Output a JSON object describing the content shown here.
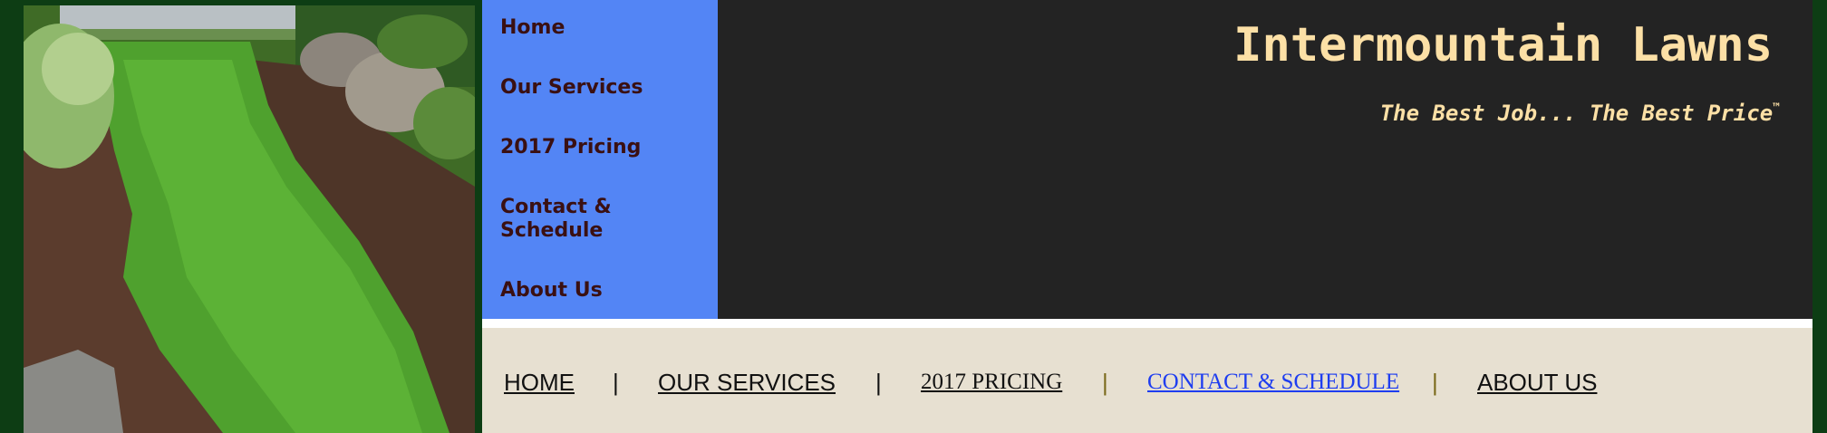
{
  "site": {
    "title": "Intermountain Lawns",
    "tagline": "The Best Job... The Best Price",
    "trademark": "™"
  },
  "side_nav": {
    "items": [
      {
        "label": "Home"
      },
      {
        "label": "Our Services"
      },
      {
        "label": "2017 Pricing"
      },
      {
        "label": "Contact & Schedule"
      },
      {
        "label": "About Us"
      }
    ]
  },
  "bottom_nav": {
    "items": [
      {
        "label": "HOME"
      },
      {
        "label": "OUR SERVICES"
      },
      {
        "label": "2017 PRICING"
      },
      {
        "label": "CONTACT & SCHEDULE"
      },
      {
        "label": "ABOUT US"
      }
    ],
    "separator": "|"
  },
  "colors": {
    "page_background": "#0d3d14",
    "side_nav_background": "#5385f5",
    "header_background": "#232323",
    "title_color": "#fce0a6",
    "bottom_nav_background": "#e7e0d1",
    "active_link_color": "#1e3df0"
  }
}
